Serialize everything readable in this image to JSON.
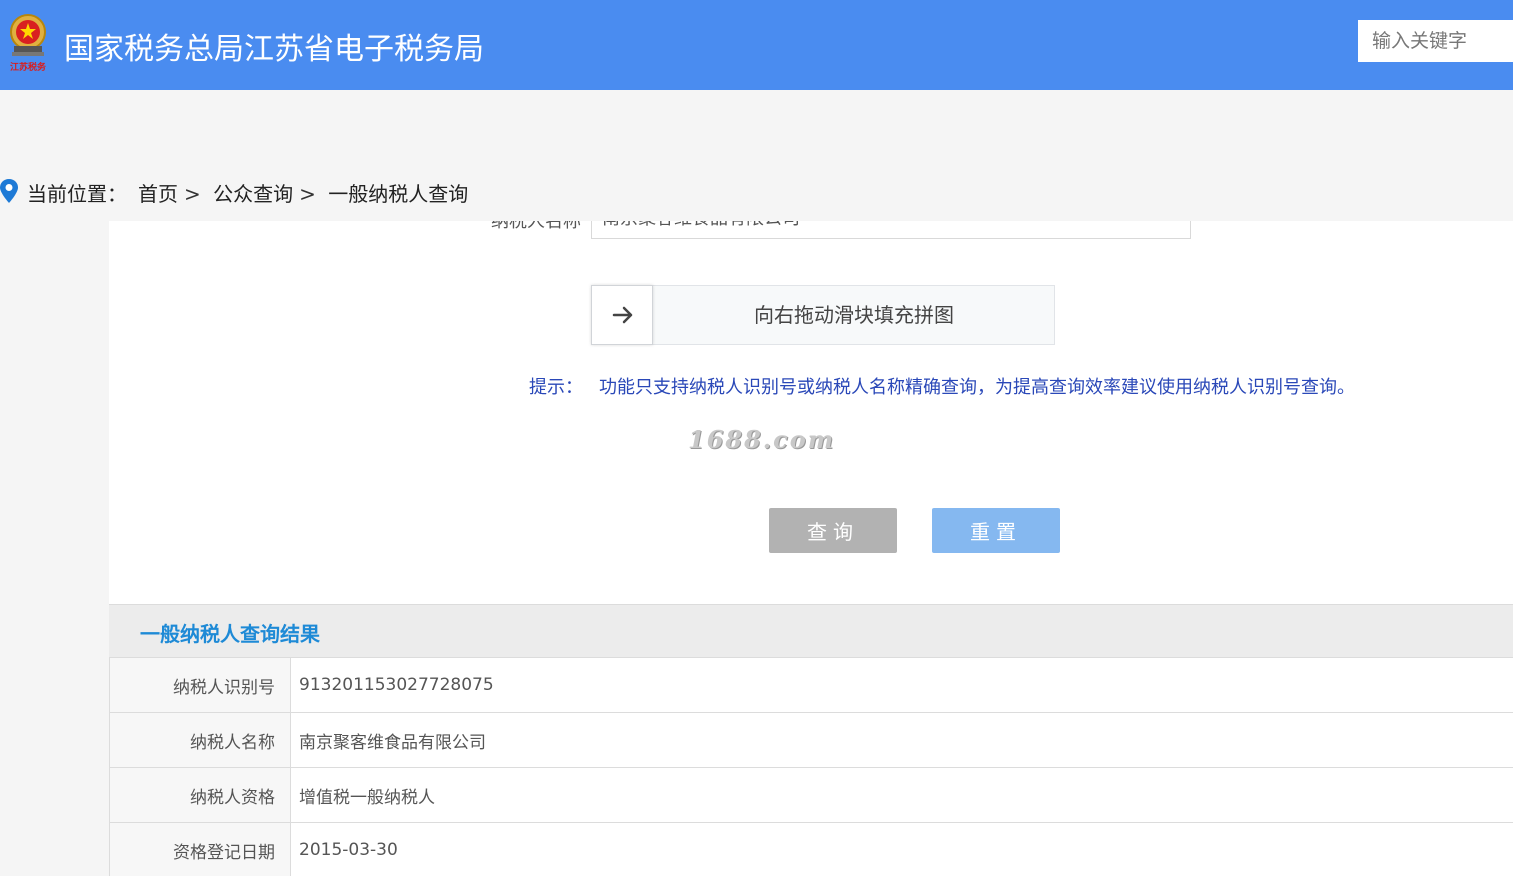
{
  "header": {
    "logo_text": "江苏税务",
    "title": "国家税务总局江苏省电子税务局",
    "search_placeholder": "输入关键字"
  },
  "breadcrumb": {
    "label": "当前位置：",
    "items": [
      "首页",
      "公众查询",
      "一般纳税人查询"
    ],
    "separator": ">"
  },
  "form": {
    "name_label": "纳税人名称",
    "name_value": "南京聚客维食品有限公司",
    "slider_text": "向右拖动滑块填充拼图",
    "hint_label": "提示：",
    "hint_text": "功能只支持纳税人识别号或纳税人名称精确查询，为提高查询效率建议使用纳税人识别号查询。",
    "watermark": "1688.com",
    "query_button": "查询",
    "reset_button": "重置"
  },
  "results": {
    "title": "一般纳税人查询结果",
    "rows": [
      {
        "label": "纳税人识别号",
        "value": "913201153027728075"
      },
      {
        "label": "纳税人名称",
        "value": "南京聚客维食品有限公司"
      },
      {
        "label": "纳税人资格",
        "value": "增值税一般纳税人"
      },
      {
        "label": "资格登记日期",
        "value": "2015-03-30"
      }
    ]
  },
  "colors": {
    "header_bg": "#4a8cf0",
    "result_title": "#1e8ad6",
    "hint": "#2a48b8",
    "query_btn": "#b2b2b2",
    "reset_btn": "#85b8f0"
  }
}
